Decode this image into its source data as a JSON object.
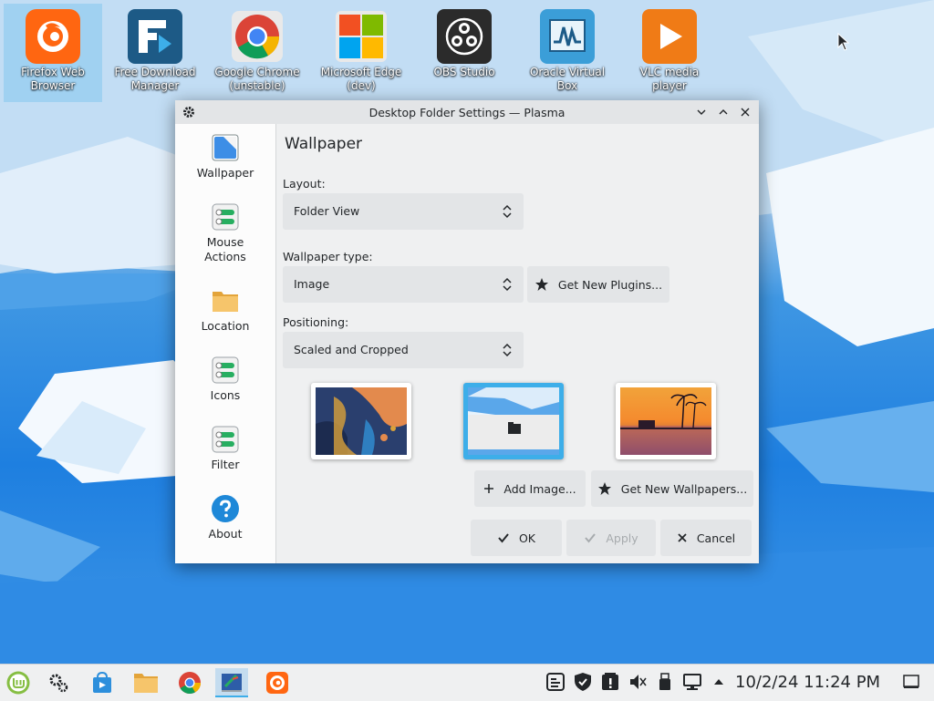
{
  "desktop": {
    "icons": [
      {
        "label": "Firefox Web Browser",
        "icon": "firefox-icon"
      },
      {
        "label": "Free Download Manager",
        "icon": "fdm-icon"
      },
      {
        "label": "Google Chrome (unstable)",
        "icon": "chrome-icon"
      },
      {
        "label": "Microsoft Edge (dev)",
        "icon": "edge-icon"
      },
      {
        "label": "OBS Studio",
        "icon": "obs-icon"
      },
      {
        "label": "Oracle Virtual Box",
        "icon": "virtualbox-icon"
      },
      {
        "label": "VLC media player",
        "icon": "vlc-icon"
      }
    ]
  },
  "dialog": {
    "title": "Desktop Folder Settings — Plasma",
    "sidebar": {
      "items": [
        {
          "label": "Wallpaper",
          "icon": "wallpaper-icon"
        },
        {
          "label": "Mouse Actions",
          "icon": "toggle-settings-icon"
        },
        {
          "label": "Location",
          "icon": "folder-icon"
        },
        {
          "label": "Icons",
          "icon": "toggle-settings-icon"
        },
        {
          "label": "Filter",
          "icon": "toggle-settings-icon"
        },
        {
          "label": "About",
          "icon": "help-icon"
        }
      ]
    },
    "content": {
      "heading": "Wallpaper",
      "layout_label": "Layout:",
      "layout_value": "Folder View",
      "wallpaper_type_label": "Wallpaper type:",
      "wallpaper_type_value": "Image",
      "get_new_plugins": "Get New Plugins...",
      "positioning_label": "Positioning:",
      "positioning_value": "Scaled and Cropped",
      "add_image": "Add Image...",
      "get_new_wallpapers": "Get New Wallpapers...",
      "ok": "OK",
      "apply": "Apply",
      "cancel": "Cancel"
    }
  },
  "taskbar": {
    "clock": "10/2/24 11:24 PM",
    "apps": [
      "mint-menu-icon",
      "settings-icon",
      "store-icon",
      "files-icon",
      "chrome-icon",
      "paint-icon",
      "firefox-icon"
    ],
    "tray": [
      "clipboard-icon",
      "shield-icon",
      "updates-icon",
      "mute-icon",
      "usb-icon",
      "network-icon",
      "expand-arrow-icon"
    ]
  },
  "colors": {
    "accent": "#3daee9",
    "window_bg": "#eff0f1",
    "button_bg": "#e3e5e7"
  }
}
